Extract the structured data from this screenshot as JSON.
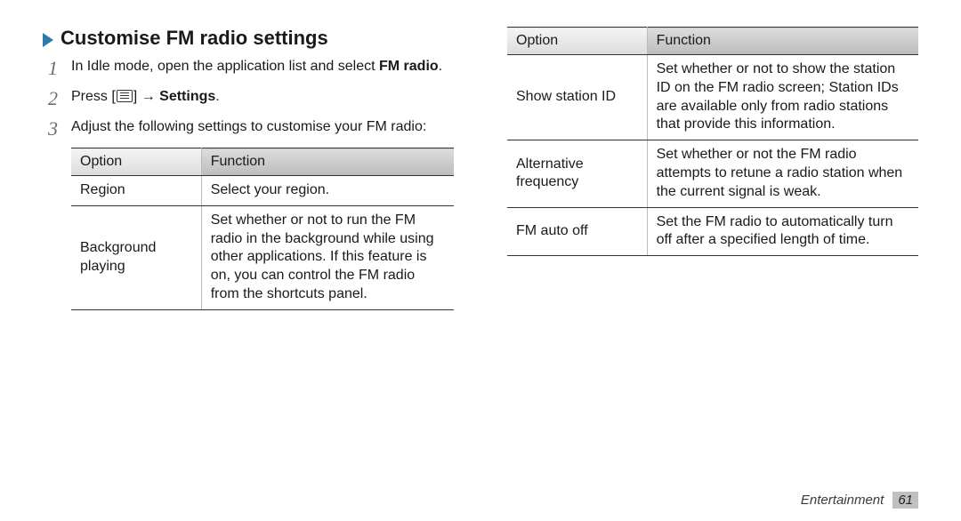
{
  "heading": "Customise FM radio settings",
  "steps": {
    "s1": {
      "num": "1",
      "text_a": "In Idle mode, open the application list and select ",
      "bold_a": "FM radio",
      "text_b": "."
    },
    "s2": {
      "num": "2",
      "text_a": "Press [",
      "text_b": "] → ",
      "bold_a": "Settings",
      "text_c": "."
    },
    "s3": {
      "num": "3",
      "text_a": "Adjust the following settings to customise your FM radio:"
    }
  },
  "table_headers": {
    "option": "Option",
    "function": "Function"
  },
  "table_left": [
    {
      "option": "Region",
      "function": "Select your region."
    },
    {
      "option": "Background playing",
      "function": "Set whether or not to run the FM radio in the background while using other applications. If this feature is on, you can control the FM radio from the shortcuts panel."
    }
  ],
  "table_right": [
    {
      "option": "Show station ID",
      "function": "Set whether or not to show the station ID on the FM radio screen; Station IDs are available only from radio stations that provide this information."
    },
    {
      "option": "Alternative frequency",
      "function": "Set whether or not the FM radio attempts to retune a radio station when the current signal is weak."
    },
    {
      "option": "FM auto off",
      "function": "Set the FM radio to automatically turn off after a specified length of time."
    }
  ],
  "footer": {
    "section": "Entertainment",
    "page": "61"
  }
}
